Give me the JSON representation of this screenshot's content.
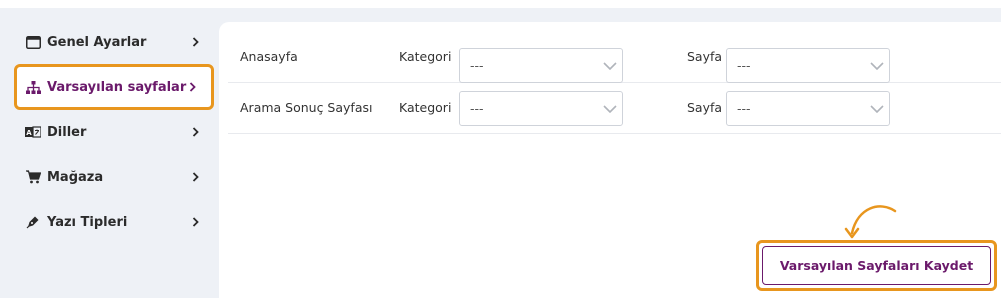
{
  "sidebar": {
    "items": [
      {
        "label": "Genel Ayarlar",
        "icon": "window-icon"
      },
      {
        "label": "Varsayılan sayfalar",
        "icon": "sitemap-icon",
        "active": true
      },
      {
        "label": "Diller",
        "icon": "language-icon"
      },
      {
        "label": "Mağaza",
        "icon": "cart-icon"
      },
      {
        "label": "Yazı Tipleri",
        "icon": "pen-icon"
      }
    ]
  },
  "rows": [
    {
      "title": "Anasayfa",
      "category_label": "Kategori",
      "category_value": "---",
      "page_label": "Sayfa",
      "page_value": "---"
    },
    {
      "title": "Arama Sonuç Sayfası",
      "category_label": "Kategori",
      "category_value": "---",
      "page_label": "Sayfa",
      "page_value": "---"
    }
  ],
  "save_button": {
    "label": "Varsayılan Sayfaları Kaydet"
  },
  "colors": {
    "accent": "#6b1a6b",
    "highlight": "#e8961e",
    "background": "#eef1f6"
  }
}
